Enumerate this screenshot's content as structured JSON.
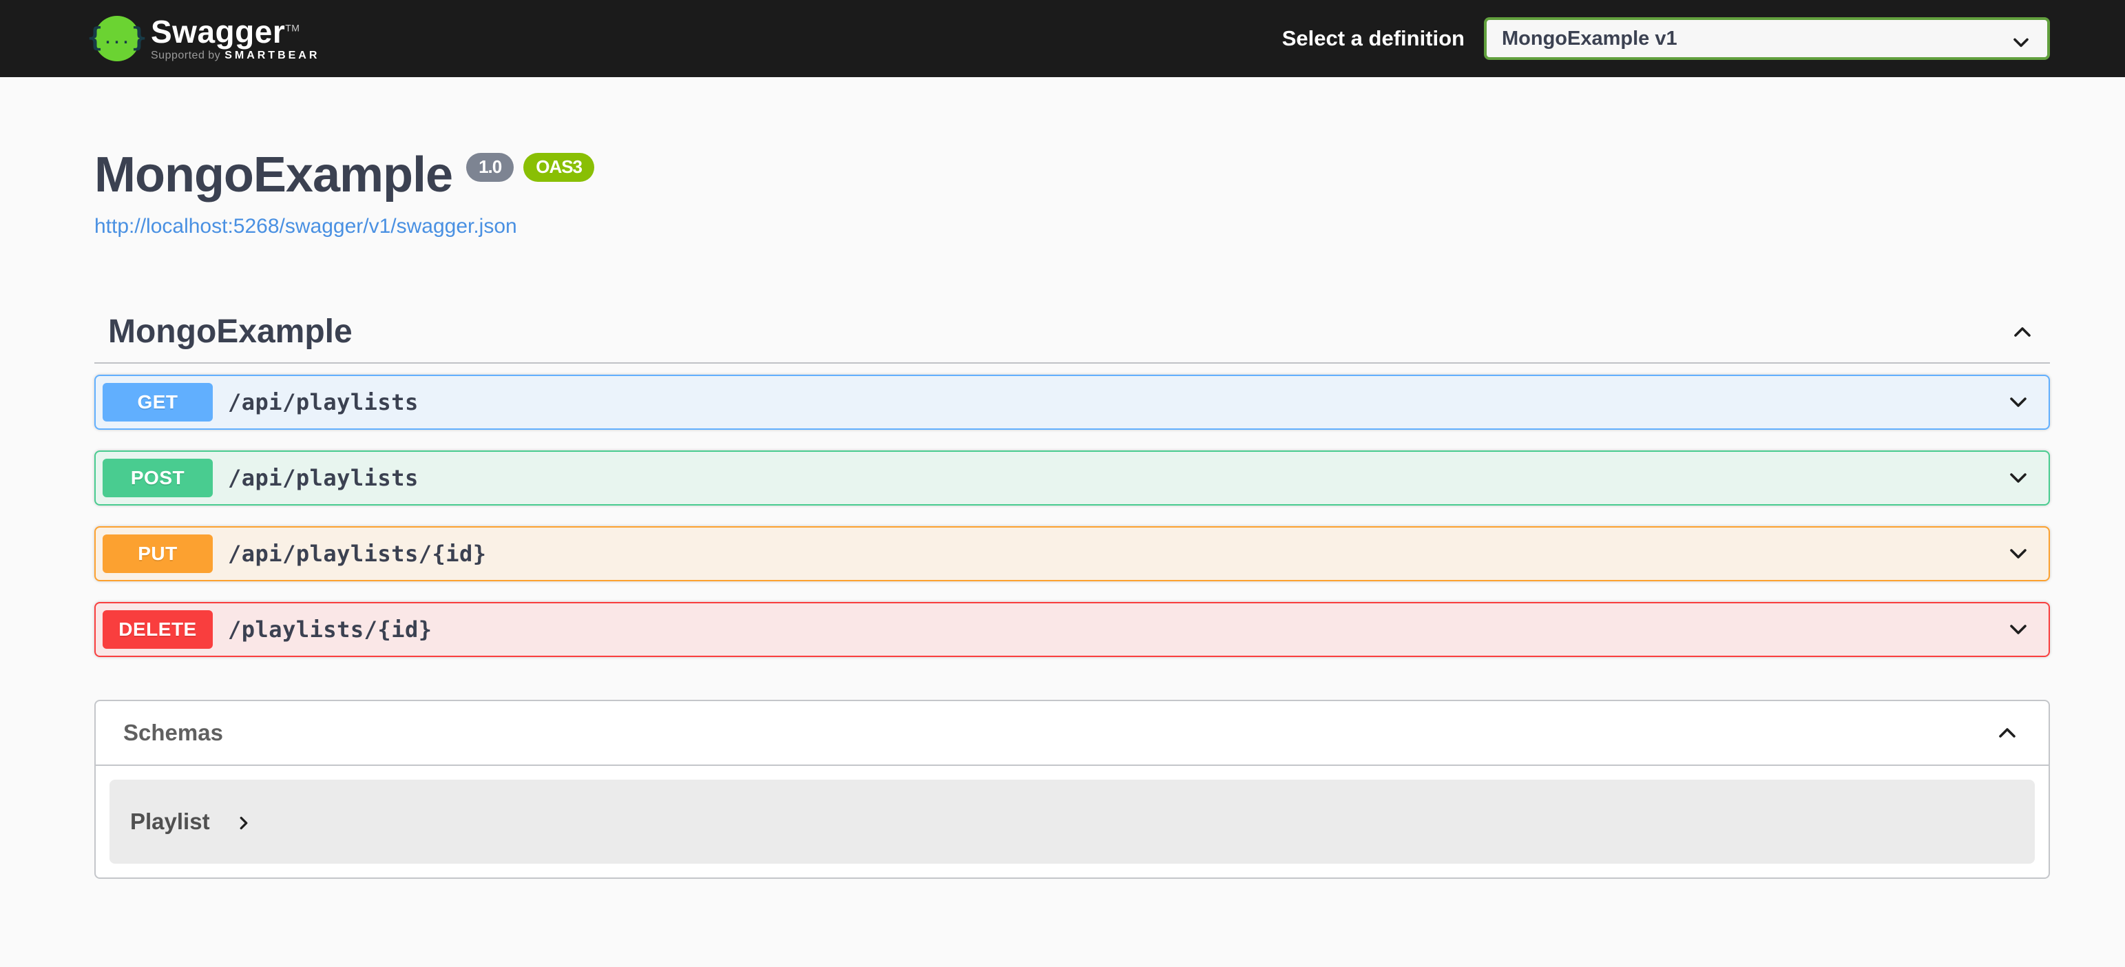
{
  "topbar": {
    "logo_text": "Swagger",
    "logo_tm": "TM",
    "tagline_prefix": "Supported by",
    "tagline_brand": "SMARTBEAR",
    "select_label": "Select a definition",
    "selected_definition": "MongoExample v1"
  },
  "info": {
    "title": "MongoExample",
    "version_badge": "1.0",
    "oas_badge": "OAS3",
    "spec_url": "http://localhost:5268/swagger/v1/swagger.json"
  },
  "tag_section": {
    "title": "MongoExample",
    "operations": [
      {
        "method": "GET",
        "path": "/api/playlists",
        "color": "#61affe",
        "background": "#ebf3fb"
      },
      {
        "method": "POST",
        "path": "/api/playlists",
        "color": "#49cc90",
        "background": "#e8f5ef"
      },
      {
        "method": "PUT",
        "path": "/api/playlists/{id}",
        "color": "#fca130",
        "background": "#faf1e6"
      },
      {
        "method": "DELETE",
        "path": "/playlists/{id}",
        "color": "#f93e3e",
        "background": "#fae7e7"
      }
    ]
  },
  "schemas": {
    "title": "Schemas",
    "models": [
      {
        "name": "Playlist"
      }
    ]
  },
  "colors": {
    "topbar_bg": "#1b1b1b",
    "brand_green": "#6bd332",
    "accent_green": "#62a03e",
    "title_text": "#3b4151",
    "link_color": "#4990e2",
    "version_badge_bg": "#7d8492",
    "oas_badge_bg": "#89bf04",
    "chevron_color": "#1f1f1f"
  }
}
